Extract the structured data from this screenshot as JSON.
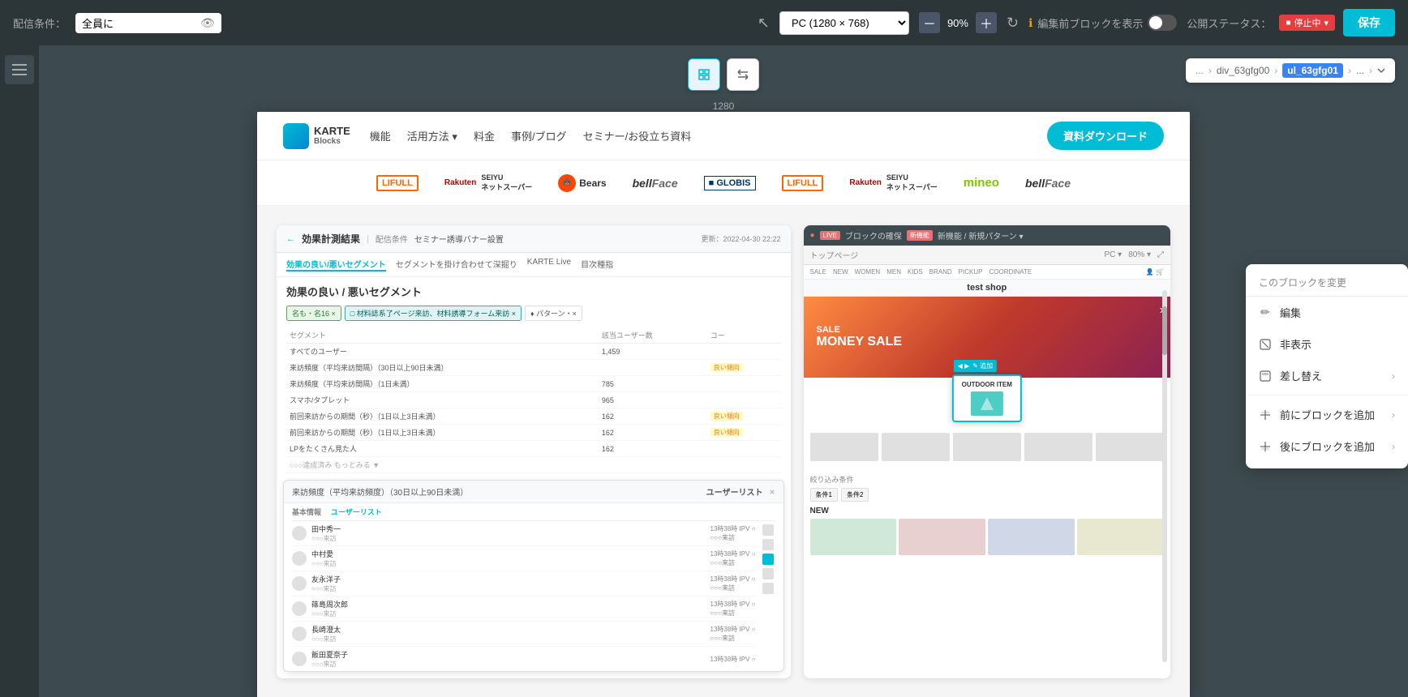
{
  "toolbar": {
    "condition_label": "配信条件：",
    "condition_value": "全員に",
    "device_label": "PC (1280 × 768)",
    "zoom_value": "90%",
    "preview_label": "編集前ブロックを表示",
    "status_label": "公開ステータス：",
    "status_value": "停止中",
    "save_label": "保存"
  },
  "breadcrumb": {
    "dots": "...",
    "item1": "div_63gfg00",
    "item2": "ul_63gfg01",
    "item3": "..."
  },
  "canvas": {
    "width_label": "1280"
  },
  "karte": {
    "logo_text": "KARTE\nBlocks",
    "nav_links": [
      "機能",
      "活用方法 ▾",
      "料金",
      "事例/ブログ",
      "セミナー/お役立ち資料"
    ],
    "cta": "資料ダウンロード"
  },
  "logos": [
    {
      "name": "LIFULL",
      "type": "lifull"
    },
    {
      "name": "Rakuten SEIYU ネットスーパー",
      "type": "rakuten"
    },
    {
      "name": "Bears",
      "type": "bears"
    },
    {
      "name": "bellFace",
      "type": "bellface"
    },
    {
      "name": "GLOBIS",
      "type": "globis"
    },
    {
      "name": "LIFULL",
      "type": "lifull2"
    },
    {
      "name": "Rakuten SEIYU ネットスーパー",
      "type": "rakuten2"
    },
    {
      "name": "mineo",
      "type": "mineo"
    },
    {
      "name": "bellFace",
      "type": "bellface2"
    }
  ],
  "analytics": {
    "back_label": "効果計測結果",
    "condition_label": "配信条件",
    "condition_value": "セミナー誘導バナー設置",
    "tabs": [
      "効果の良い/悪いセグメント",
      "セグメントを掛け合わせて深掘り",
      "KARTE Live",
      "目次種指"
    ],
    "active_tab": "効果の良い/悪いセグメント",
    "section_title": "効果の良い / 悪いセグメント",
    "filter_tags": [
      "名も・名16 ×",
      "□ 材料誌系了ページ来訪、材料誘導フォーム来訪 ×",
      "♦ パターン・×"
    ],
    "table_headers": [
      "セグメント",
      "該当ユーザー数",
      "コー"
    ],
    "table_rows": [
      {
        "label": "すべてのユーザー",
        "count": "1,459",
        "tags": []
      },
      {
        "label": "来訪頻度（平均来訪間隔）（30日以上90日未満）",
        "count": "",
        "tags": [
          "良い傾向"
        ]
      },
      {
        "label": "来訪頻度（平均来訪間隔）（1日未満）",
        "count": "785",
        "tags": []
      },
      {
        "label": "スマホ/タブレット",
        "count": "965",
        "tags": []
      },
      {
        "label": "前回来訪からの期間（秒）（1日以上3日未満）",
        "count": "162",
        "tags": [
          "良い傾向"
        ]
      },
      {
        "label": "前回来訪からの期間（秒）（1日以上3日未満）",
        "count": "162",
        "tags": [
          "良い傾向"
        ]
      },
      {
        "label": "LPをたくさん見た人",
        "count": "162",
        "tags": []
      },
      {
        "label": "○○○達成済みもっとみる ▼",
        "count": "",
        "tags": []
      }
    ],
    "popup": {
      "title": "来訪頻度（平均来訪頻度）（30日以上90日未満）",
      "subtitle": "ユーザーリスト",
      "users": [
        {
          "name": "田中秀一",
          "time": "13時38時 IPV ○"
        },
        {
          "name": "中村愛",
          "time": "13時38時 IPV ○"
        },
        {
          "name": "友永洋子",
          "time": "13時38時 IPV ○"
        },
        {
          "name": "篠島周次郎",
          "time": "13時38時 IPV ○"
        },
        {
          "name": "長崎澄太",
          "time": "13時38時 IPV ○"
        },
        {
          "name": "飯田夏奈子",
          "time": "13時38時 IPV ○"
        }
      ]
    }
  },
  "shop": {
    "url": "トップページ",
    "nav_items": [
      "SALE",
      "NEW",
      "WOMEN",
      "MEN",
      "KIDS",
      "BRAND",
      "PICKUP",
      "COORDINATE"
    ],
    "hero_title": "MONEY SALE",
    "section_title": "NEW",
    "block_label": "OUTDOOR ITEM"
  },
  "context_menu": {
    "header": "このブロックを変更",
    "items": [
      {
        "icon": "✏️",
        "label": "編集",
        "arrow": false
      },
      {
        "icon": "⊘",
        "label": "非表示",
        "arrow": false
      },
      {
        "icon": "⊡",
        "label": "差し替え",
        "arrow": true
      },
      {
        "divider": true
      },
      {
        "icon": "↑",
        "label": "前にブロックを追加",
        "arrow": true
      },
      {
        "icon": "↓",
        "label": "後にブロックを追加",
        "arrow": true
      }
    ]
  }
}
